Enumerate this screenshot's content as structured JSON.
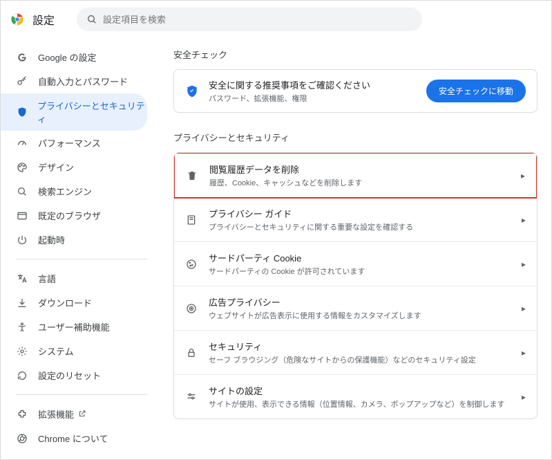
{
  "header": {
    "title": "設定",
    "search_placeholder": "設定項目を検索"
  },
  "sidebar": {
    "group1": [
      {
        "label": "Google の設定"
      },
      {
        "label": "自動入力とパスワード"
      },
      {
        "label": "プライバシーとセキュリティ"
      },
      {
        "label": "パフォーマンス"
      },
      {
        "label": "デザイン"
      },
      {
        "label": "検索エンジン"
      },
      {
        "label": "既定のブラウザ"
      },
      {
        "label": "起動時"
      }
    ],
    "group2": [
      {
        "label": "言語"
      },
      {
        "label": "ダウンロード"
      },
      {
        "label": "ユーザー補助機能"
      },
      {
        "label": "システム"
      },
      {
        "label": "設定のリセット"
      }
    ],
    "group3": [
      {
        "label": "拡張機能"
      },
      {
        "label": "Chrome について"
      }
    ]
  },
  "main": {
    "safety_section_title": "安全チェック",
    "safety_card": {
      "title": "安全に関する推奨事項をご確認ください",
      "sub": "パスワード、拡張機能、権限",
      "button": "安全チェックに移動"
    },
    "privacy_section_title": "プライバシーとセキュリティ",
    "rows": [
      {
        "title": "閲覧履歴データを削除",
        "sub": "履歴、Cookie、キャッシュなどを削除します"
      },
      {
        "title": "プライバシー ガイド",
        "sub": "プライバシーとセキュリティに関する重要な設定を確認する"
      },
      {
        "title": "サードパーティ Cookie",
        "sub": "サードパーティの Cookie が許可されています"
      },
      {
        "title": "広告プライバシー",
        "sub": "ウェブサイトが広告表示に使用する情報をカスタマイズします"
      },
      {
        "title": "セキュリティ",
        "sub": "セーフ ブラウジング（危険なサイトからの保護機能）などのセキュリティ設定"
      },
      {
        "title": "サイトの設定",
        "sub": "サイトが使用、表示できる情報（位置情報、カメラ、ポップアップなど）を制御します"
      }
    ]
  }
}
